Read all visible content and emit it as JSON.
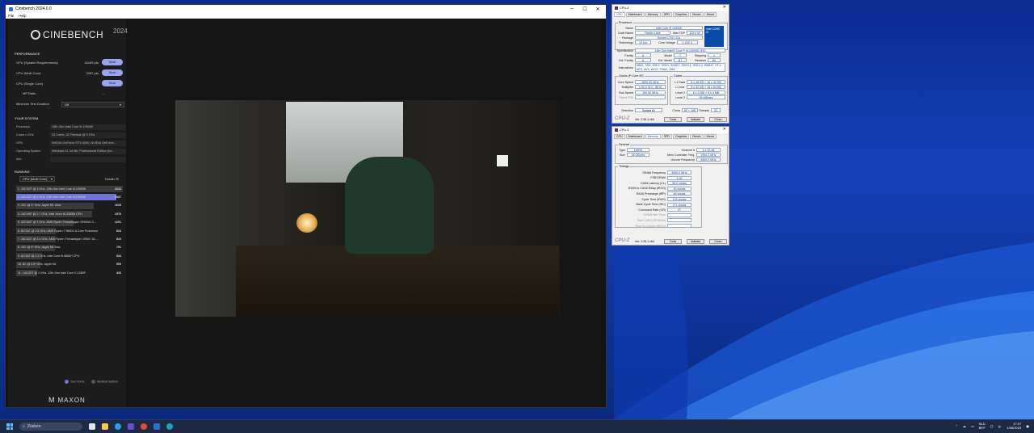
{
  "cinebench": {
    "window_title": "Cinebench 2024.0.0",
    "menu": [
      "File",
      "Help"
    ],
    "logo_text": "CINEBENCH",
    "logo_year": "2024",
    "performance": {
      "heading": "PERFORMANCE",
      "rows": [
        {
          "label": "GPU (System Requirements)",
          "points": "16189 pts",
          "button": "Start"
        },
        {
          "label": "CPU (Multi Core)",
          "points": "2087 pts",
          "button": "Start"
        },
        {
          "label": "CPU (Single Core)",
          "points": "",
          "button": "Start"
        }
      ],
      "mp_ratio_label": "MP Ratio",
      "mp_ratio_value": "--",
      "min_duration_label": "Minimum Test Duration",
      "min_duration_value": "Off"
    },
    "system": {
      "heading": "YOUR SYSTEM",
      "rows": [
        {
          "k": "Processor",
          "v": "13th Gen Intel Core i9-13900K"
        },
        {
          "k": "Cores x GHz",
          "v": "24 Cores, 32 Threads @ 3 GHz"
        },
        {
          "k": "GPU",
          "v": "NVIDIA GeForce RTX 4090, NVIDIA GeForce..."
        },
        {
          "k": "Operating System",
          "v": "Windows 11, 64 Bit, Professional Edition (bu..."
        },
        {
          "k": "Info",
          "v": ""
        }
      ]
    },
    "ranking": {
      "heading": "RANKING",
      "dropdown": "CPU (Multi Core)",
      "details": "Details",
      "items": [
        {
          "name": "1. 24C/32T @ 3 GHz, 13th Gen Intel Core i9-13900K",
          "score": "2212",
          "pct": 100,
          "kind": "normal"
        },
        {
          "name": "2. 24C/32T @ 3 GHz, 13th Gen Intel Core i9-13900K",
          "score": "2087",
          "pct": 94,
          "kind": "you"
        },
        {
          "name": "3. 20C @ 3* GHz, Apple M1 Ultra",
          "score": "1625",
          "pct": 73,
          "kind": "normal"
        },
        {
          "name": "4. 24C/48T @ 2.7 GHz, Intel Xeon W-3265M CPU",
          "score": "1579",
          "pct": 71,
          "kind": "normal"
        },
        {
          "name": "5. 32C/64T @ 3 GHz, AMD Ryzen Threadripper 2990WX 3...",
          "score": "1201",
          "pct": 54,
          "kind": "normal"
        },
        {
          "name": "6. 8C/16T @ 3.8 GHz, AMD Ryzen 7 5800X 8-Core Processor",
          "score": "824",
          "pct": 37,
          "kind": "normal"
        },
        {
          "name": "7. 16C/32T @ 3.4 GHz, AMD Ryzen Threadripper 1950X 16-...",
          "score": "810",
          "pct": 37,
          "kind": "normal"
        },
        {
          "name": "8. 10C @ 3* GHz, Apple M1 Max",
          "score": "791",
          "pct": 36,
          "kind": "normal"
        },
        {
          "name": "9. 8C/16T @ 2.3 GHz, Intel Core i9-9880H CPU",
          "score": "534",
          "pct": 24,
          "kind": "normal"
        },
        {
          "name": "10. 8C @ 2.5* GHz, Apple M1",
          "score": "509",
          "pct": 23,
          "kind": "normal"
        },
        {
          "name": "11. 14C/20T @ 2 GHz, 12th Gen Intel Core i7-1280P",
          "score": "433",
          "pct": 20,
          "kind": "normal"
        }
      ],
      "legend": [
        "Your Score",
        "Identical System"
      ],
      "legend_colors": [
        "#6f74d8",
        "#555"
      ]
    },
    "footer_logo": "MAXON"
  },
  "cpuz1": {
    "title": "CPU-Z",
    "tabs": [
      "CPU",
      "Mainboard",
      "Memory",
      "SPD",
      "Graphics",
      "Bench",
      "About"
    ],
    "active_tab": "CPU",
    "processor_group": "Processor",
    "name_k": "Name",
    "name_v": "Intel Core i9 13900K",
    "codename_k": "Code Name",
    "codename_v": "Raptor Lake",
    "maxtdp_k": "Max TDP",
    "maxtdp_v": "125.0 W",
    "package_k": "Package",
    "package_v": "Socket 1700 LGA",
    "tech_k": "Technology",
    "tech_v": "10 nm",
    "corevolt_k": "Core Voltage",
    "corevolt_v": "1.209 V",
    "spec_k": "Specification",
    "spec_v": "13th Gen Intel® Core™ i9-13900K (ES)",
    "family_k": "Family",
    "family_v": "6",
    "model_k": "Model",
    "model_v": "7",
    "stepping_k": "Stepping",
    "stepping_v": "1",
    "extfam_k": "Ext. Family",
    "extfam_v": "6",
    "extmodel_k": "Ext. Model",
    "extmodel_v": "B7",
    "revision_k": "Revision",
    "revision_v": "B0",
    "instr_k": "Instructions",
    "instr_v": "MMX, SSE, SSE2, SSE3, SSSE3, SSE4.1, SSE4.2, EM64T, VT-x, AES, AVX, AVX2, FMA3, SHA",
    "clocks_group": "Clocks (P-Core #0)",
    "corespeed_k": "Core Speed",
    "corespeed_v": "3000.00 MHz",
    "mult_k": "Multiplier",
    "mult_v": "x 30.0 (8.0 - 55.0)",
    "bus_k": "Bus Speed",
    "bus_v": "100.00 MHz",
    "fsb_k": "Rated FSB",
    "fsb_v": "",
    "cache_group": "Cache",
    "l1d_k": "L1 Data",
    "l1d_v": "8 x 48 KB + 16 x 32 KB",
    "l1i_k": "L1 Inst.",
    "l1i_v": "8 x 32 KB + 16 x 64 KB",
    "l2_k": "Level 2",
    "l2_v": "8 x 2 MB + 4 x 4 MB",
    "l3_k": "Level 3",
    "l3_v": "36 MBytes",
    "sel_k": "Selection",
    "sel_v": "Socket #1",
    "cores_k": "Cores",
    "cores_v": "8P + 16E",
    "threads_k": "Threads",
    "threads_v": "32",
    "logo": "CPU-Z",
    "version": "Ver. 2.05.1.x64",
    "tools": "Tools",
    "validate": "Validate",
    "close": "Close",
    "intel_badge": "intel CORE i9"
  },
  "cpuz2": {
    "title": "CPU-Z",
    "tabs": [
      "CPU",
      "Mainboard",
      "Memory",
      "SPD",
      "Graphics",
      "Bench",
      "About"
    ],
    "active_tab": "Memory",
    "general_group": "General",
    "type_k": "Type",
    "type_v": "DDR5",
    "size_k": "Size",
    "size_v": "48 GBytes",
    "channel_k": "Channel #",
    "channel_v": "4 x 32-bit",
    "mcf_k": "Mem Controller Freq.",
    "mcf_v": "1950.0 MHz",
    "uncore_k": "Uncore Frequency",
    "uncore_v": "4000.0 MHz",
    "timings_group": "Timings",
    "timings": [
      {
        "k": "DRAM Frequency",
        "v": "3900.0 MHz",
        "dim": false
      },
      {
        "k": "FSB:DRAM",
        "v": "1:39",
        "dim": false
      },
      {
        "k": "CAS# Latency (CL)",
        "v": "36.0 clocks",
        "dim": false
      },
      {
        "k": "RAS# to CAS# Delay (tRCD)",
        "v": "46 clocks",
        "dim": false
      },
      {
        "k": "RAS# Precharge (tRP)",
        "v": "46 clocks",
        "dim": false
      },
      {
        "k": "Cycle Time (tRAS)",
        "v": "125 clocks",
        "dim": false
      },
      {
        "k": "Bank Cycle Time (tRC)",
        "v": "171 clocks",
        "dim": false
      },
      {
        "k": "Command Rate (CR)",
        "v": "2T",
        "dim": false
      },
      {
        "k": "DRAM Idle Timer",
        "v": "",
        "dim": true
      },
      {
        "k": "Total CAS# (tRDRAM)",
        "v": "",
        "dim": true
      },
      {
        "k": "Row To Column (tRCD)",
        "v": "",
        "dim": true
      }
    ],
    "logo": "CPU-Z",
    "version": "Ver. 2.05.1.x64",
    "tools": "Tools",
    "validate": "Validate",
    "close": "Close"
  },
  "taskbar": {
    "search_placeholder": "Zoeken",
    "lang_top": "NLD",
    "lang_bottom": "BEP",
    "time": "17:07",
    "date": "1/08/2023"
  }
}
